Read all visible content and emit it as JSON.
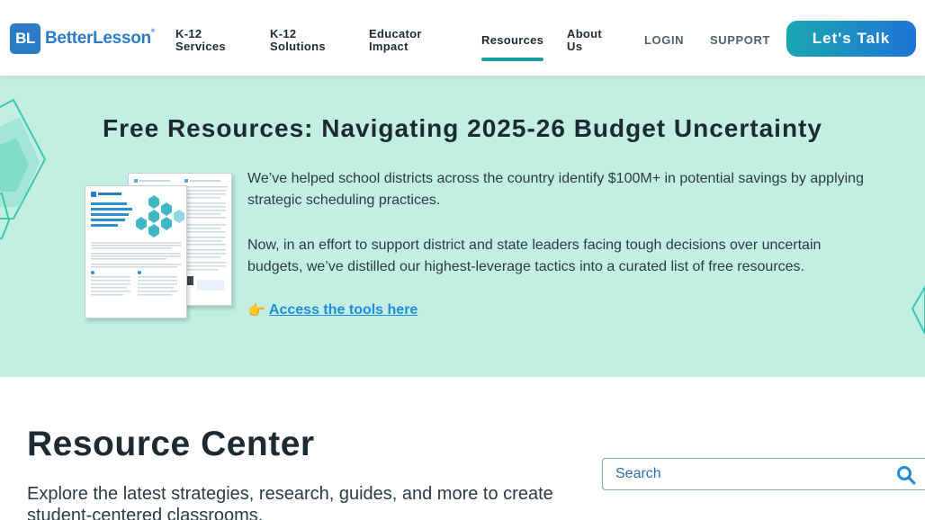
{
  "header": {
    "logo": {
      "mark": "BL",
      "name": "BetterLesson",
      "tm": "®"
    },
    "nav": [
      {
        "label": "K-12 Services"
      },
      {
        "label": "K-12 Solutions"
      },
      {
        "label": "Educator Impact"
      },
      {
        "label": "Resources",
        "active": true
      },
      {
        "label": "About Us"
      }
    ],
    "login": "LOGIN",
    "support": "SUPPORT",
    "cta": "Let's Talk"
  },
  "banner": {
    "title": "Free Resources: Navigating 2025-26 Budget Uncertainty",
    "paragraph1": "We’ve helped school districts across the country identify $100M+ in potential savings by applying strategic scheduling practices.",
    "paragraph2": "Now, in an effort to support district and state leaders facing tough decisions over uncertain budgets, we’ve distilled our highest-leverage tactics into a curated list of free resources.",
    "link_emoji": "👉",
    "link_text": "Access the tools here",
    "flyer": {
      "brand": "BetterLesson",
      "headline": "Doing more with less: navigating budgetary challenges through strategic scheduling & staffing"
    }
  },
  "resource_center": {
    "title": "Resource Center",
    "subtitle": "Explore the latest strategies, research, guides, and more to create student-centered classrooms.",
    "search_placeholder": "Search"
  },
  "colors": {
    "brand_blue": "#2c7bc7",
    "banner_bg": "#c3efe3",
    "active_underline": "#17a2a2",
    "link_blue": "#1f8cd6"
  },
  "icons": [
    "search-icon",
    "hexagon-decoration"
  ]
}
